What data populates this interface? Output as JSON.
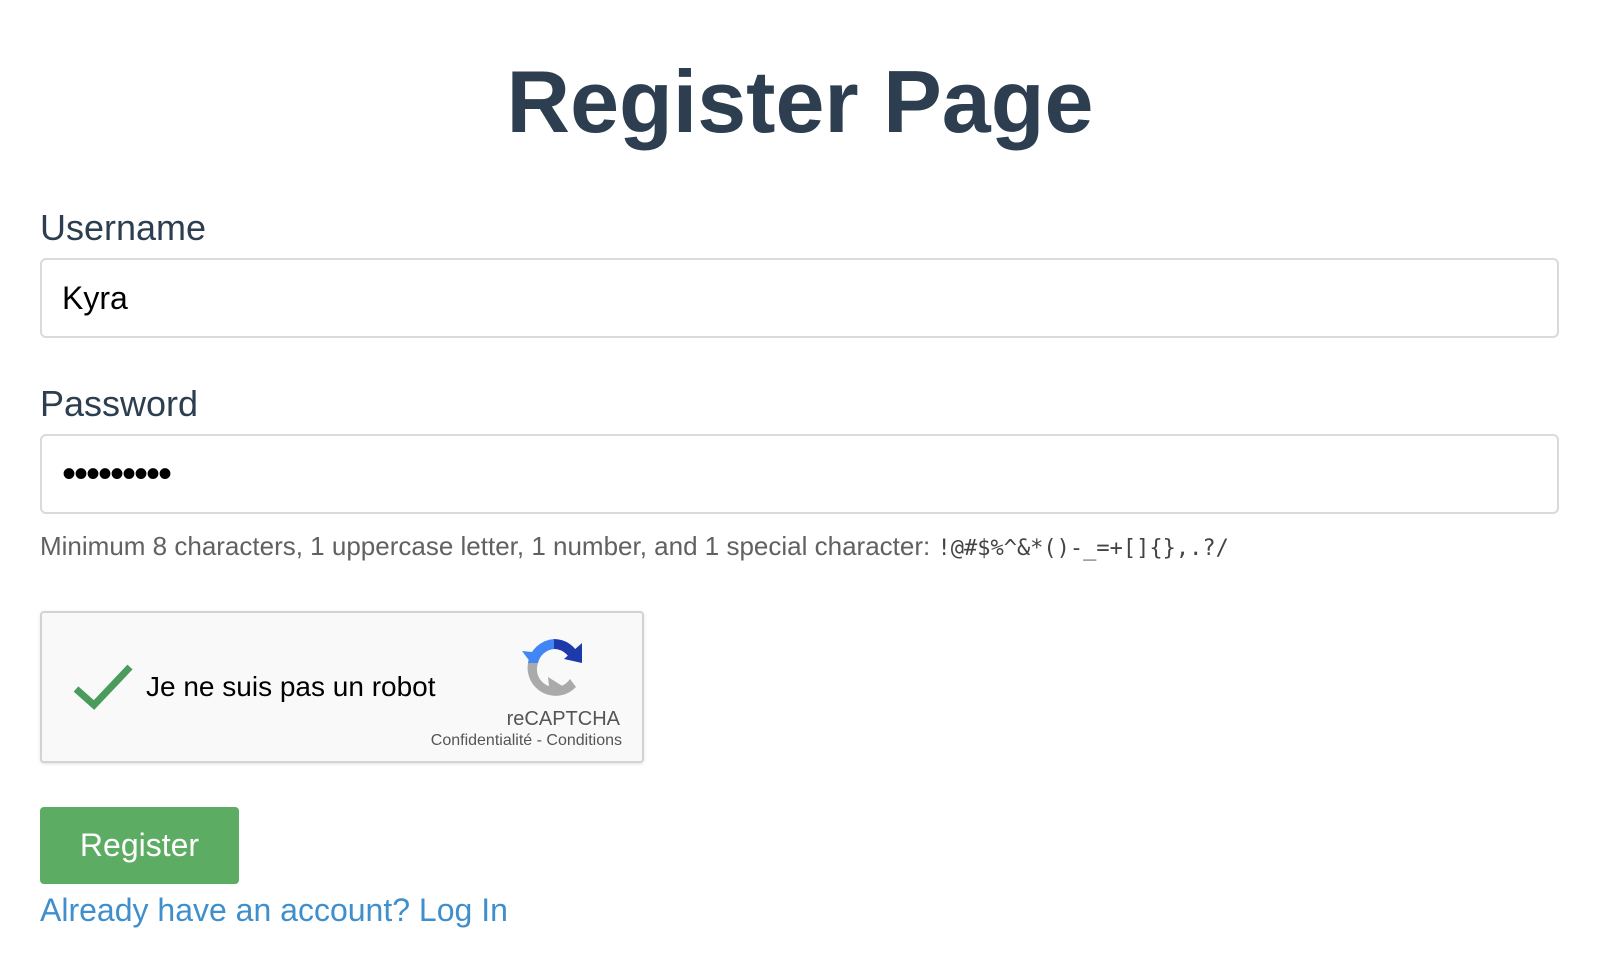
{
  "page": {
    "title": "Register Page"
  },
  "form": {
    "username": {
      "label": "Username",
      "value": "Kyra"
    },
    "password": {
      "label": "Password",
      "value": "•••••••••",
      "hint": "Minimum 8 characters, 1 uppercase letter, 1 number, and 1 special character:",
      "hint_chars": "!@#$%^&*()-_=+[]{},.?/"
    },
    "recaptcha": {
      "label": "Je ne suis pas un robot",
      "brand": "reCAPTCHA",
      "privacy": "Confidentialité",
      "separator": " - ",
      "terms": "Conditions",
      "checked": true
    },
    "submit_label": "Register",
    "login_link": "Already have an account? Log In"
  },
  "colors": {
    "heading": "#2c3e50",
    "button": "#5cad63",
    "link": "#3f8fcd",
    "checkmark": "#4a9b5c"
  }
}
